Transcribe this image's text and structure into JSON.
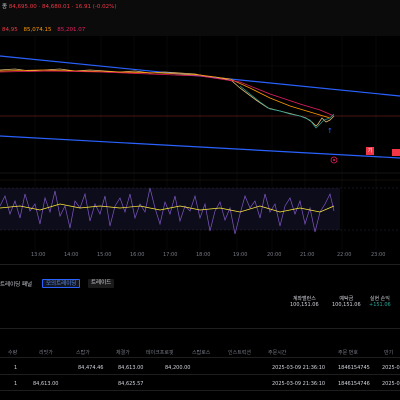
{
  "header": {
    "symbol_prefix": "종",
    "ohlc": "84,695.00 · 84,680.01 · 16.91 (-0.02%)",
    "ma_values": [
      "84,95",
      "85,074.15",
      "85,201.07"
    ]
  },
  "colors": {
    "up": "#26a69a",
    "down": "#f23645",
    "accent": "#2962ff",
    "channel_line": "#2962ff",
    "price_line": "#e0b870",
    "rsi_line": "#7e57c2",
    "rsi_signal": "#ffeb3b"
  },
  "price_chart": {
    "price_flag": "기"
  },
  "time_axis": [
    "13:00",
    "14:00",
    "15:00",
    "16:00",
    "17:00",
    "18:00",
    "19:00",
    "20:00",
    "21:00",
    "22:00",
    "23:00"
  ],
  "panel": {
    "title": "트레이딩 패널",
    "tabs": [
      {
        "label": "모의트레이딩",
        "active": true
      },
      {
        "label": "트레이드",
        "active": false
      }
    ],
    "stats": [
      {
        "label": "계좌밸런스",
        "value": "100,151.06"
      },
      {
        "label": "예탁금",
        "value": "100,151.06"
      },
      {
        "label": "실현 손익",
        "value": "+151.06"
      }
    ]
  },
  "orders_table": {
    "columns": [
      "수량",
      "리밋가",
      "스탑가",
      "체결가",
      "테이크프로핏",
      "스탑로스",
      "인스트럭션",
      "주문시간",
      "주문 번호",
      "만기"
    ],
    "rows": [
      [
        "1",
        "",
        "84,474.46",
        "84,613.00",
        "84,200.00",
        "",
        "2025-03-09 21:36:10",
        "1846154745",
        "2025-0"
      ],
      [
        "1",
        "84,613.00",
        "",
        "84,625.57",
        "",
        "",
        "2025-03-09 21:36:10",
        "1846154746",
        "2025-0"
      ]
    ]
  }
}
